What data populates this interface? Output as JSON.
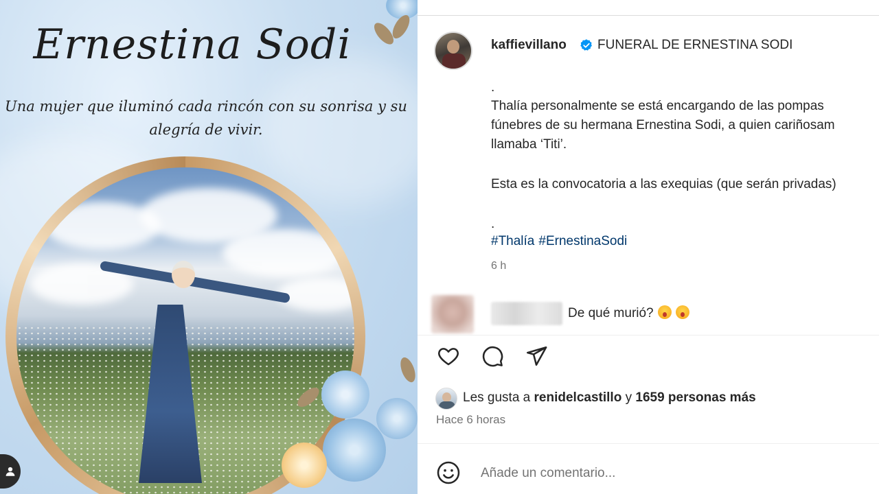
{
  "post_image": {
    "name_script": "Ernestina Sodi",
    "quote_line1": "Una mujer que iluminó cada rincón con su sonrisa y su",
    "quote_line2": "alegría de vivir."
  },
  "post": {
    "username": "kaffievillano",
    "title": "FUNERAL DE ERNESTINA SODI",
    "caption_lines": [
      ".",
      "Thalía personalmente se está encargando de las pompas",
      "fúnebres de su hermana Ernestina Sodi, a quien cariñosam",
      "llamaba ‘Titi’.",
      "Esta es la convocatoria a las exequias (que serán privadas)",
      "."
    ],
    "hashtags": [
      "#Thalía",
      "#ErnestinaSodi"
    ],
    "time": "6 h"
  },
  "comment": {
    "text": "De qué murió?"
  },
  "actions": {
    "like_icon": "heart-icon",
    "comment_icon": "speech-bubble-icon",
    "share_icon": "paper-plane-icon"
  },
  "likes": {
    "prefix": "Les gusta a",
    "user": "renidelcastillo",
    "joiner": "y",
    "others": "1659 personas más"
  },
  "timestamp": "Hace 6 horas",
  "add_comment": {
    "placeholder": "Añade un comentario..."
  },
  "colors": {
    "text": "#262626",
    "secondary": "#737373",
    "hashtag": "#00376b",
    "verified": "#0095f6"
  }
}
